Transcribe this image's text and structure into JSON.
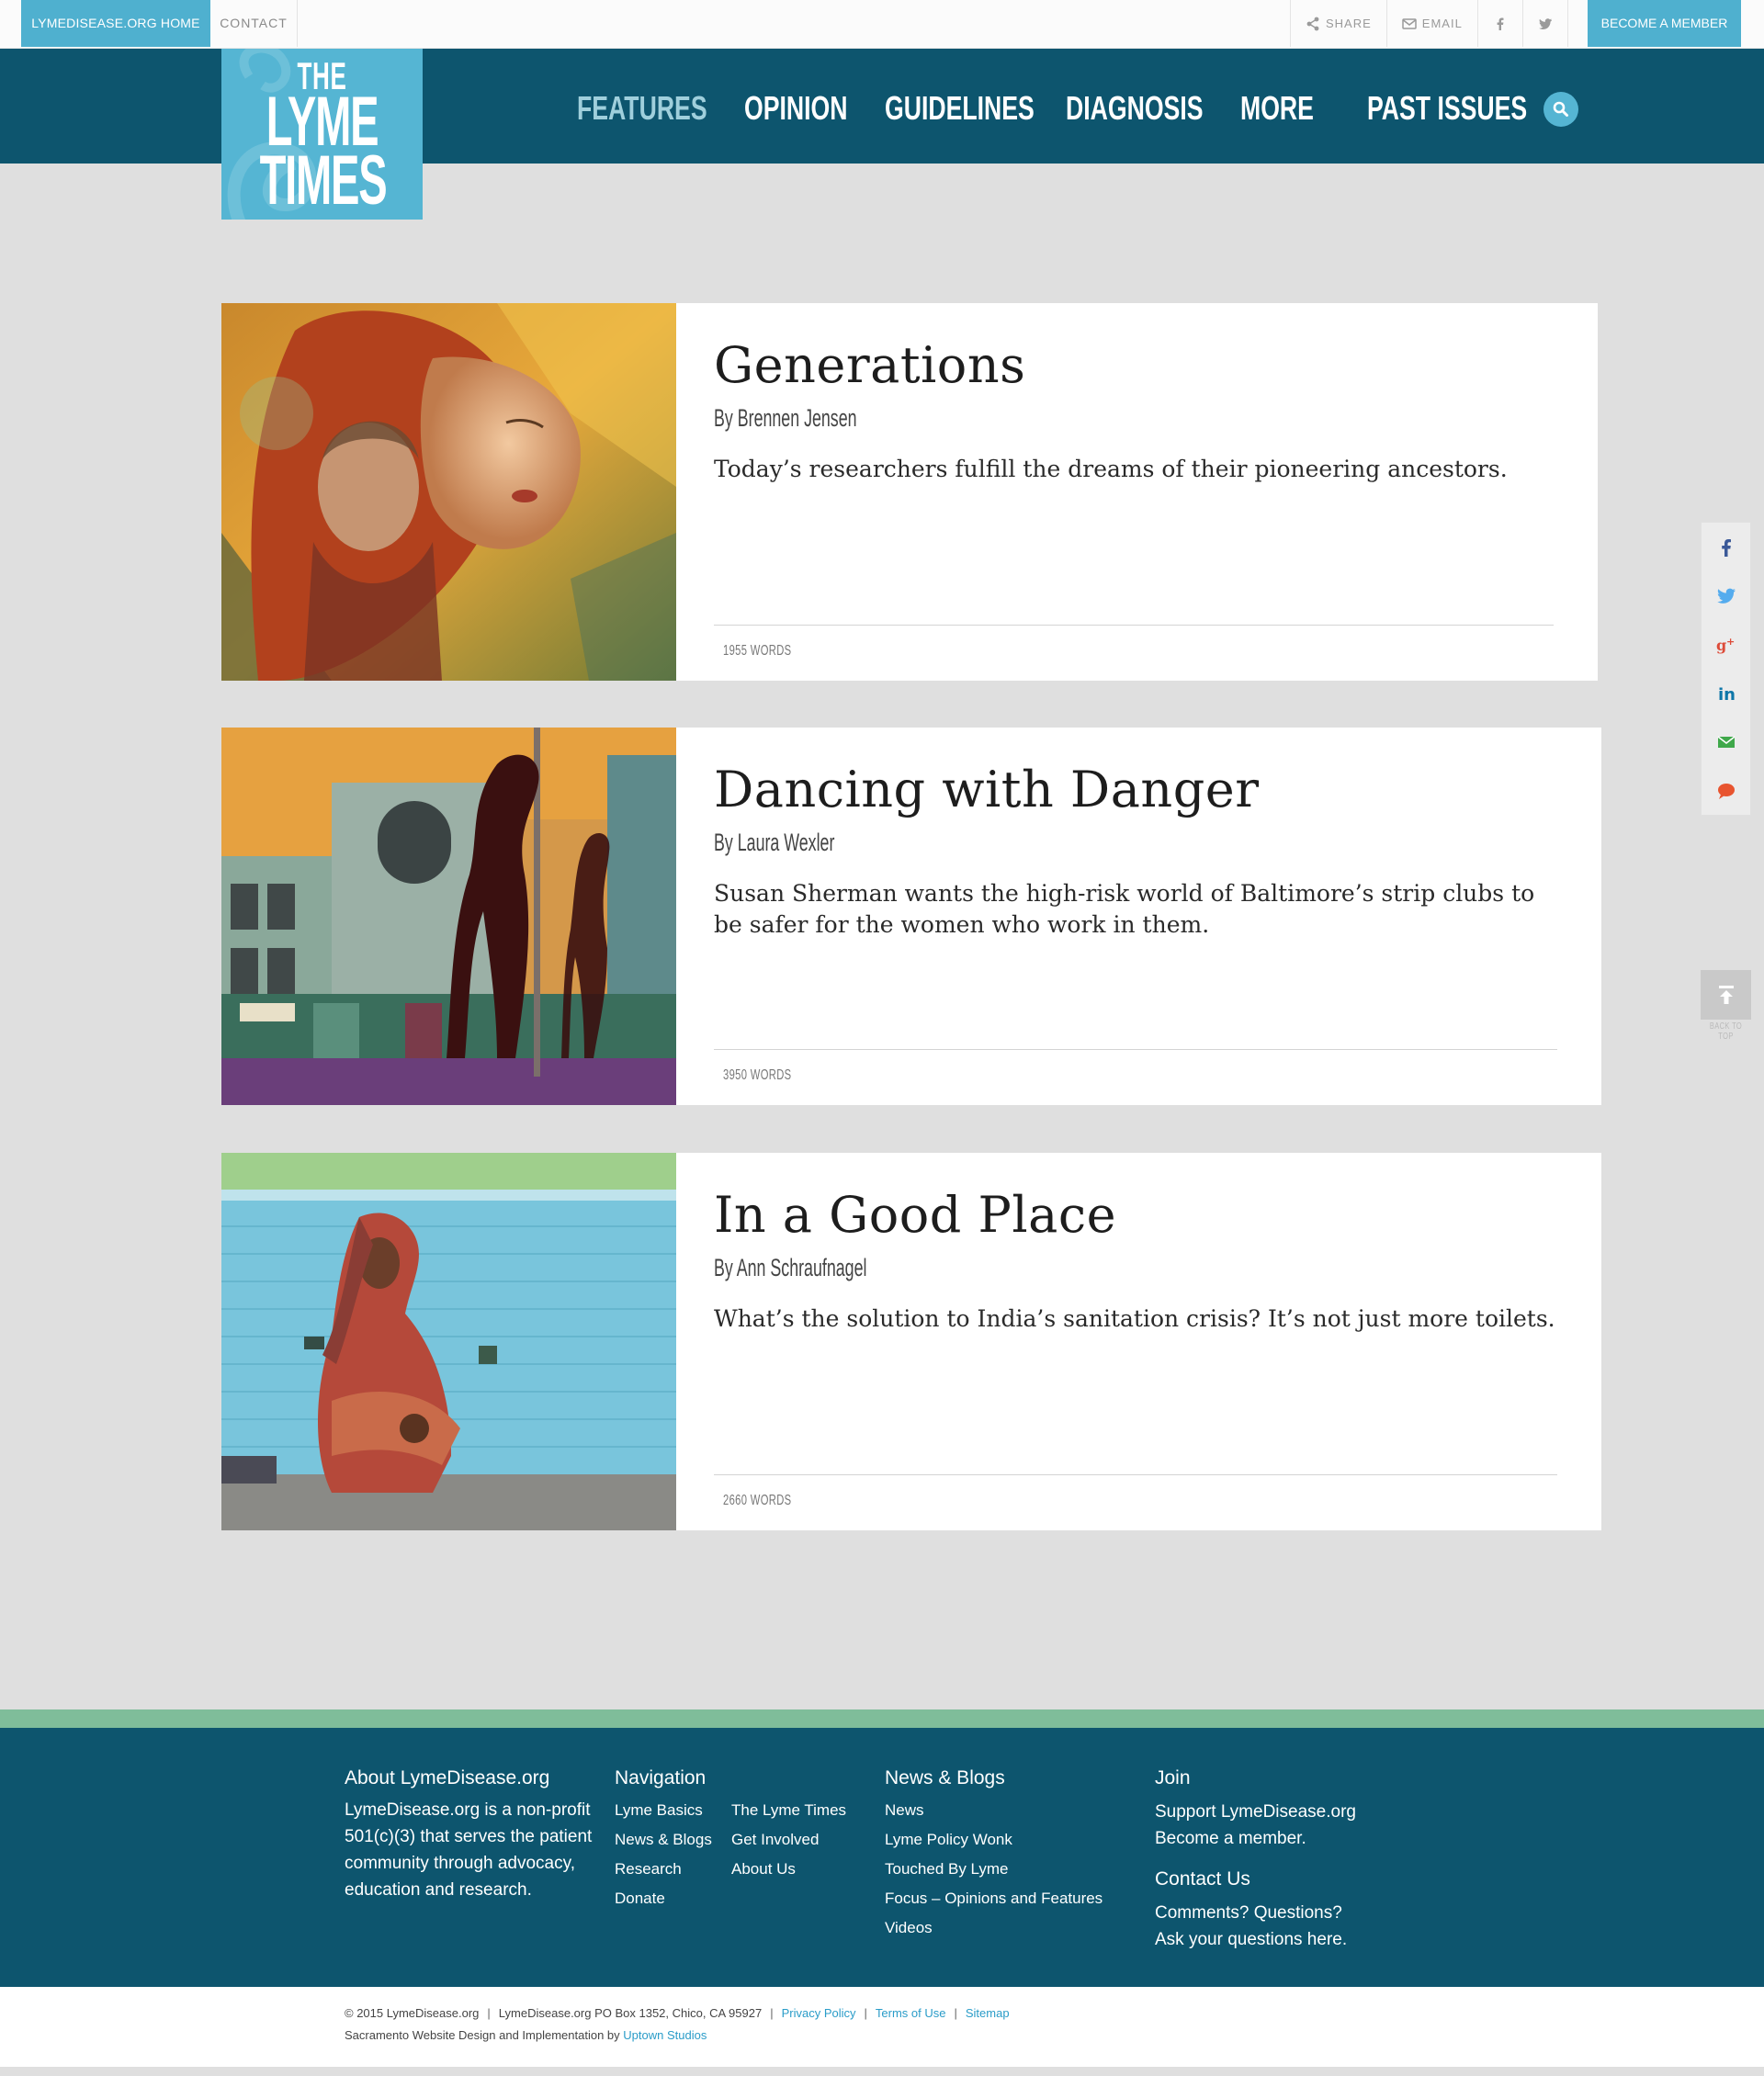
{
  "utility": {
    "home_label": "LYMEDISEASE.ORG HOME",
    "contact_label": "CONTACT",
    "share_label": "SHARE",
    "email_label": "EMAIL",
    "facebook_icon": "facebook-icon",
    "twitter_icon": "twitter-icon",
    "member_label": "BECOME A MEMBER"
  },
  "logo": {
    "line1": "THE",
    "line2": "LYME",
    "line3": "TIMES"
  },
  "nav": {
    "items": [
      {
        "label": "FEATURES",
        "active": true
      },
      {
        "label": "OPINION",
        "active": false
      },
      {
        "label": "GUIDELINES",
        "active": false
      },
      {
        "label": "DIAGNOSIS",
        "active": false
      },
      {
        "label": "MORE",
        "active": false
      },
      {
        "label": "PAST ISSUES",
        "active": false
      }
    ],
    "search_icon": "search-icon"
  },
  "articles": [
    {
      "title": "Generations",
      "byline": "By Brennen Jensen",
      "dek": "Today’s researchers fulfill the dreams of their pioneering ancestors.",
      "words": "1955 WORDS"
    },
    {
      "title": "Dancing with Danger",
      "byline": "By Laura Wexler",
      "dek": "Susan Sherman wants the high-risk world of Baltimore’s strip clubs to be safer for the women who work in them.",
      "words": "3950 WORDS"
    },
    {
      "title": "In a Good Place",
      "byline": "By Ann Schraufnagel",
      "dek": "What’s the solution to India’s sanitation crisis? It’s not just more toilets.",
      "words": "2660 WORDS"
    }
  ],
  "share_rail": [
    "facebook-icon",
    "twitter-icon",
    "google-plus-icon",
    "linkedin-icon",
    "email-icon",
    "comment-icon"
  ],
  "back_to_top": "BACK TO TOP",
  "footer": {
    "about": {
      "heading": "About LymeDisease.org",
      "text": "LymeDisease.org is a non-profit 501(c)(3) that serves the patient community through advocacy, education and research."
    },
    "navigation": {
      "heading": "Navigation",
      "col1": [
        "Lyme Basics",
        "News & Blogs",
        "Research",
        "Donate"
      ],
      "col2": [
        "The Lyme Times",
        "Get Involved",
        "About Us"
      ]
    },
    "news": {
      "heading": "News & Blogs",
      "links": [
        "News",
        "Lyme Policy Wonk",
        "Touched By Lyme",
        "Focus – Opinions and Features",
        "Videos"
      ]
    },
    "join": {
      "heading": "Join",
      "line1": "Support LymeDisease.org",
      "line2": "Become a member."
    },
    "contact": {
      "heading": "Contact Us",
      "line1": "Comments? Questions?",
      "line2": "Ask your questions here."
    }
  },
  "bottom": {
    "copyright": "© 2015 LymeDisease.org",
    "address": "LymeDisease.org PO Box 1352, Chico, CA 95927",
    "privacy": "Privacy Policy",
    "terms": "Terms of Use",
    "sitemap": "Sitemap",
    "credit_text": "Sacramento Website Design and Implementation by",
    "credit_link": "Uptown Studios"
  },
  "colors": {
    "nav_bg": "#0d556e",
    "accent": "#4fb0cf",
    "footer_stripe": "#7fbd9a",
    "page_bg": "#dfdfdf"
  }
}
